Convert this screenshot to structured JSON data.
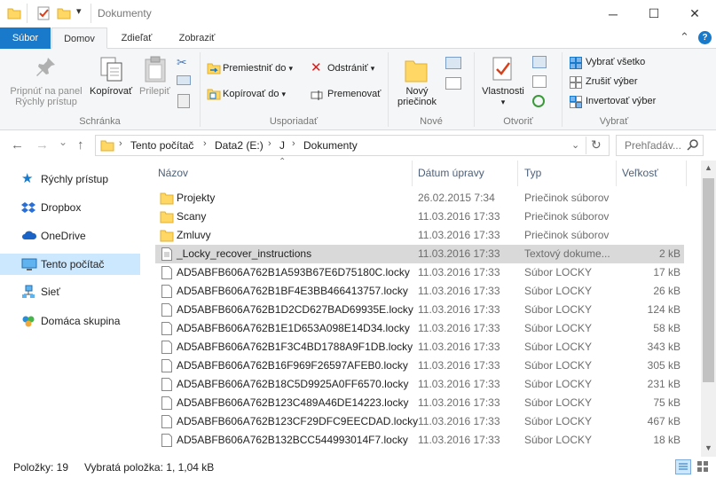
{
  "window": {
    "title": "Dokumenty",
    "minimize_glyph": "─",
    "maximize_glyph": "☐",
    "close_glyph": "✕",
    "qa_dropdown_glyph": "▾"
  },
  "ribbon": {
    "tabs": [
      {
        "label": "Súbor"
      },
      {
        "label": "Domov"
      },
      {
        "label": "Zdieľať"
      },
      {
        "label": "Zobraziť"
      }
    ],
    "collapse_glyph": "⌃",
    "help_glyph": "?",
    "groups": {
      "clipboard": {
        "label": "Schránka",
        "pin_line1": "Pripnúť na panel",
        "pin_line2": "Rýchly prístup",
        "copy": "Kopírovať",
        "paste": "Prilepiť"
      },
      "organize": {
        "label": "Usporiadať",
        "move_to": "Premiestniť do",
        "copy_to": "Kopírovať do",
        "delete": "Odstrániť",
        "rename": "Premenovať"
      },
      "new": {
        "label": "Nové",
        "new_folder_line1": "Nový",
        "new_folder_line2": "priečinok"
      },
      "open": {
        "label": "Otvoriť",
        "properties": "Vlastnosti"
      },
      "select": {
        "label": "Vybrať",
        "select_all": "Vybrať všetko",
        "select_none": "Zrušiť výber",
        "invert": "Invertovať výber"
      }
    }
  },
  "address": {
    "crumbs": [
      "Tento počítač",
      "Data2 (E:)",
      "J",
      "Dokumenty"
    ],
    "separator": "›",
    "search_placeholder": "Prehľadáv...",
    "back_glyph": "←",
    "forward_glyph": "→",
    "recent_glyph": "⌄",
    "up_glyph": "↑",
    "refresh_glyph": "↻"
  },
  "nav": {
    "items": [
      {
        "label": "Rýchly prístup"
      },
      {
        "label": "Dropbox"
      },
      {
        "label": "OneDrive"
      },
      {
        "label": "Tento počítač"
      },
      {
        "label": "Sieť"
      },
      {
        "label": "Domáca skupina"
      }
    ]
  },
  "list": {
    "columns": {
      "name": "Názov",
      "date": "Dátum úpravy",
      "type": "Typ",
      "size": "Veľkosť"
    },
    "rows": [
      {
        "name": "Projekty",
        "date": "26.02.2015 7:34",
        "type": "Priečinok súborov",
        "size": "",
        "kind": "folder"
      },
      {
        "name": "Scany",
        "date": "11.03.2016 17:33",
        "type": "Priečinok súborov",
        "size": "",
        "kind": "folder"
      },
      {
        "name": "Zmluvy",
        "date": "11.03.2016 17:33",
        "type": "Priečinok súborov",
        "size": "",
        "kind": "folder"
      },
      {
        "name": "_Locky_recover_instructions",
        "date": "11.03.2016 17:33",
        "type": "Textový dokume...",
        "size": "2 kB",
        "kind": "text"
      },
      {
        "name": "AD5ABFB606A762B1A593B67E6D75180C.locky",
        "date": "11.03.2016 17:33",
        "type": "Súbor LOCKY",
        "size": "17 kB",
        "kind": "file"
      },
      {
        "name": "AD5ABFB606A762B1BF4E3BB466413757.locky",
        "date": "11.03.2016 17:33",
        "type": "Súbor LOCKY",
        "size": "26 kB",
        "kind": "file"
      },
      {
        "name": "AD5ABFB606A762B1D2CD627BAD69935E.locky",
        "date": "11.03.2016 17:33",
        "type": "Súbor LOCKY",
        "size": "124 kB",
        "kind": "file"
      },
      {
        "name": "AD5ABFB606A762B1E1D653A098E14D34.locky",
        "date": "11.03.2016 17:33",
        "type": "Súbor LOCKY",
        "size": "58 kB",
        "kind": "file"
      },
      {
        "name": "AD5ABFB606A762B1F3C4BD1788A9F1DB.locky",
        "date": "11.03.2016 17:33",
        "type": "Súbor LOCKY",
        "size": "343 kB",
        "kind": "file"
      },
      {
        "name": "AD5ABFB606A762B16F969F26597AFEB0.locky",
        "date": "11.03.2016 17:33",
        "type": "Súbor LOCKY",
        "size": "305 kB",
        "kind": "file"
      },
      {
        "name": "AD5ABFB606A762B18C5D9925A0FF6570.locky",
        "date": "11.03.2016 17:33",
        "type": "Súbor LOCKY",
        "size": "231 kB",
        "kind": "file"
      },
      {
        "name": "AD5ABFB606A762B123C489A46DE14223.locky",
        "date": "11.03.2016 17:33",
        "type": "Súbor LOCKY",
        "size": "75 kB",
        "kind": "file"
      },
      {
        "name": "AD5ABFB606A762B123CF29DFC9EECDAD.locky",
        "date": "11.03.2016 17:33",
        "type": "Súbor LOCKY",
        "size": "467 kB",
        "kind": "file"
      },
      {
        "name": "AD5ABFB606A762B132BCC544993014F7.locky",
        "date": "11.03.2016 17:33",
        "type": "Súbor LOCKY",
        "size": "18 kB",
        "kind": "file"
      }
    ]
  },
  "status": {
    "items_count": "Položky: 19",
    "selected": "Vybratá položka: 1, 1,04 kB"
  },
  "colors": {
    "accent": "#1979ca",
    "selection": "#cce8ff",
    "row_selected": "#d9d9d9",
    "folder": "#ffd764"
  }
}
